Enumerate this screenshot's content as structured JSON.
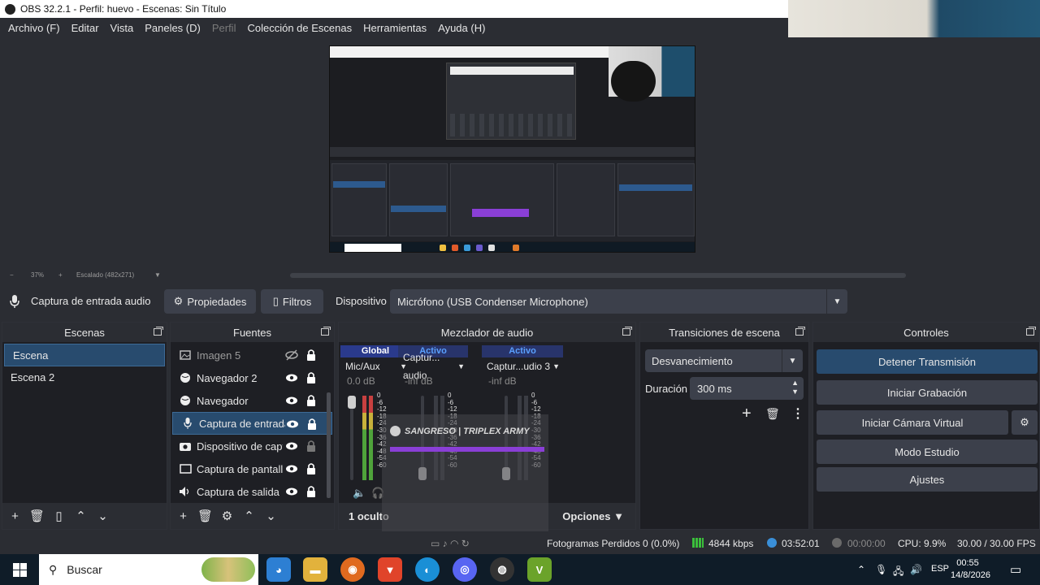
{
  "window": {
    "title": "OBS 32.2.1 - Perfil: huevo - Escenas: Sin Título"
  },
  "menu": {
    "items": [
      {
        "label": "Archivo (F)",
        "enabled": true
      },
      {
        "label": "Editar",
        "enabled": true
      },
      {
        "label": "Vista",
        "enabled": true
      },
      {
        "label": "Paneles (D)",
        "enabled": true
      },
      {
        "label": "Perfil",
        "enabled": false
      },
      {
        "label": "Colección de Escenas",
        "enabled": true
      },
      {
        "label": "Herramientas",
        "enabled": true
      },
      {
        "label": "Ayuda (H)",
        "enabled": true
      }
    ]
  },
  "preview": {
    "zoom": "37%",
    "scale_label": "Escalado (482x271)"
  },
  "source_toolbar": {
    "source_name": "Captura de entrada audio",
    "properties_label": "Propiedades",
    "filters_label": "Filtros",
    "device_label": "Dispositivo",
    "device_value": "Micrófono (USB Condenser Microphone)"
  },
  "scenes": {
    "title": "Escenas",
    "items": [
      {
        "label": "Escena",
        "selected": true
      },
      {
        "label": "Escena 2",
        "selected": false
      }
    ]
  },
  "sources": {
    "title": "Fuentes",
    "items": [
      {
        "label": "Imagen 5",
        "icon": "image-icon",
        "visible": false,
        "locked": true
      },
      {
        "label": "Navegador 2",
        "icon": "globe-icon",
        "visible": true,
        "locked": true
      },
      {
        "label": "Navegador",
        "icon": "globe-icon",
        "visible": true,
        "locked": true
      },
      {
        "label": "Captura de entrada audio",
        "icon": "microphone-icon",
        "visible": true,
        "locked": true,
        "selected": true
      },
      {
        "label": "Dispositivo de captura",
        "icon": "camera-icon",
        "visible": true,
        "locked": false
      },
      {
        "label": "Captura de pantalla",
        "icon": "monitor-icon",
        "visible": true,
        "locked": true
      },
      {
        "label": "Captura de salida de audio",
        "icon": "speaker-icon",
        "visible": true,
        "locked": true
      }
    ]
  },
  "mixer": {
    "title": "Mezclador de audio",
    "channels": [
      {
        "tag": "Global",
        "name": "Mic/Aux",
        "db": "0.0 dB"
      },
      {
        "tag": "Activo",
        "name": "Captur... audio",
        "db": "-inf dB"
      },
      {
        "tag": "Activo",
        "name": "Captur...udio 3",
        "db": "-inf dB"
      }
    ],
    "scale": [
      "0",
      "-6",
      "-12",
      "-18",
      "-24",
      "-30",
      "-36",
      "-42",
      "-48",
      "-54",
      "-60"
    ],
    "hidden_label": "1 oculto",
    "options_label": "Opciones"
  },
  "overlay": {
    "text": "SANGRESO | TRIPLEX ARMY"
  },
  "transitions": {
    "title": "Transiciones de escena",
    "selected": "Desvanecimiento",
    "duration_label": "Duración",
    "duration_value": "300 ms"
  },
  "controls": {
    "title": "Controles",
    "stop_stream": "Detener Transmisión",
    "start_recording": "Iniciar Grabación",
    "start_virtual_cam": "Iniciar Cámara Virtual",
    "studio_mode": "Modo Estudio",
    "settings": "Ajustes"
  },
  "status": {
    "dropped_frames": "Fotogramas Perdidos 0 (0.0%)",
    "bitrate": "4844 kbps",
    "stream_time": "03:52:01",
    "record_time": "00:00:00",
    "cpu": "CPU: 9.9%",
    "fps": "30.00 / 30.00 FPS"
  },
  "taskbar": {
    "search_placeholder": "Buscar",
    "lang": "ESP",
    "time": "00:55",
    "date": "14/8/2026"
  },
  "colors": {
    "accent": "#284b6e",
    "panel": "#1e1f24",
    "background": "#2b2d33",
    "button": "#3c404b"
  }
}
